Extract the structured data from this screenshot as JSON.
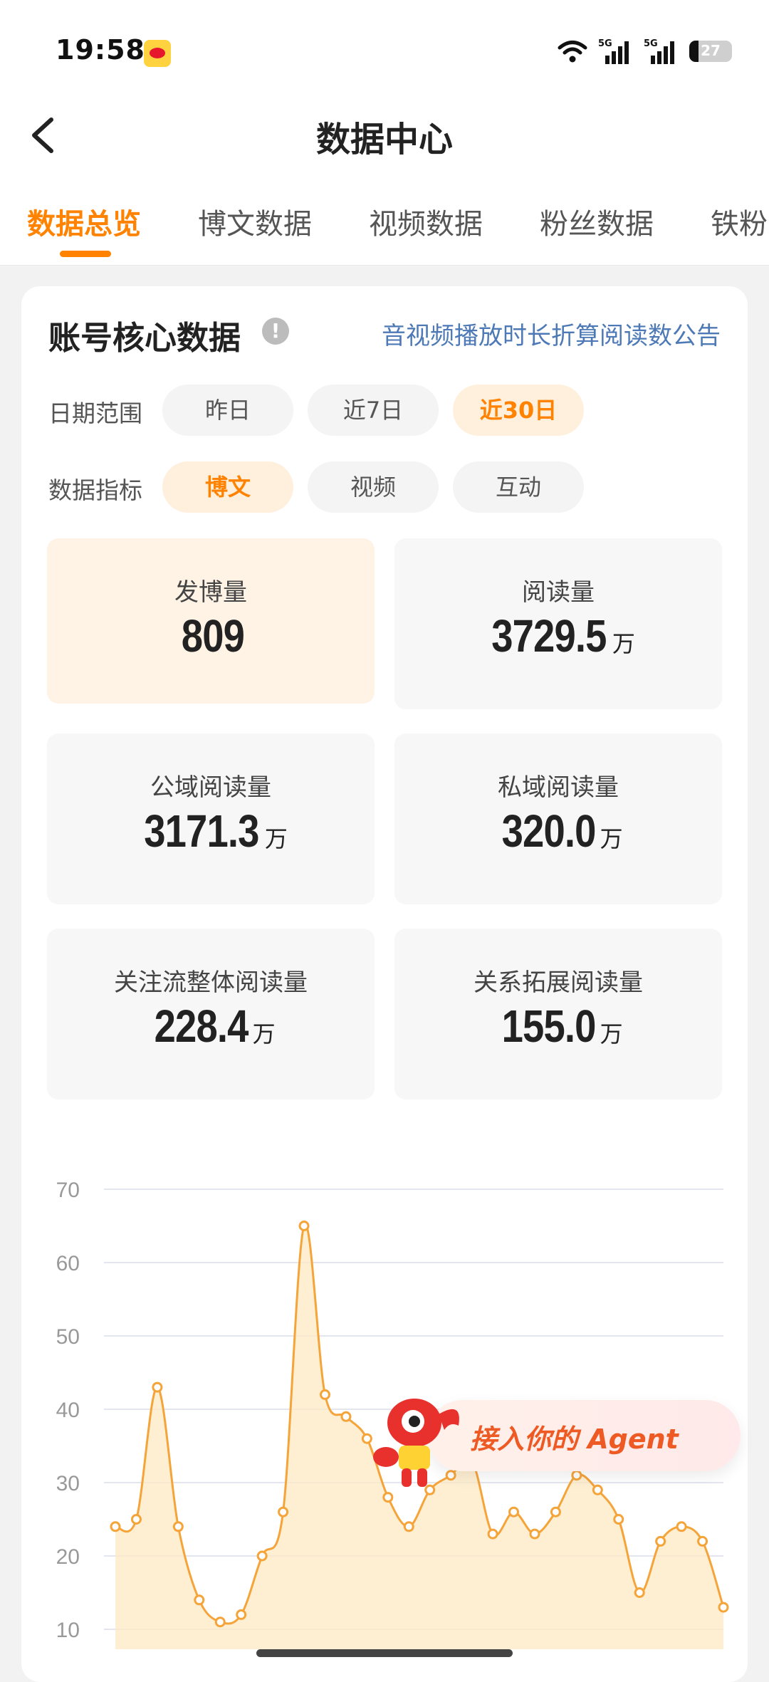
{
  "status_bar": {
    "time": "19:58",
    "network_1": "5G",
    "network_2": "5G",
    "battery": "27",
    "icons": [
      "weibo-icon",
      "wifi-icon",
      "signal-icon",
      "signal-icon",
      "battery-icon"
    ]
  },
  "nav": {
    "title": "数据中心",
    "back_icon": "chevron-left-icon"
  },
  "tabs": [
    {
      "label": "数据总览",
      "active": true
    },
    {
      "label": "博文数据"
    },
    {
      "label": "视频数据"
    },
    {
      "label": "粉丝数据"
    },
    {
      "label": "铁粉"
    }
  ],
  "card": {
    "title": "账号核心数据",
    "notice_link": "音视频播放时长折算阅读数公告",
    "date_range": {
      "label": "日期范围",
      "options": [
        "昨日",
        "近7日",
        "近30日"
      ],
      "selected": "近30日"
    },
    "metric": {
      "label": "数据指标",
      "options": [
        "博文",
        "视频",
        "互动"
      ],
      "selected": "博文"
    },
    "stats": [
      {
        "label": "发博量",
        "value": "809",
        "unit": "",
        "active": true
      },
      {
        "label": "阅读量",
        "value": "3729.5",
        "unit": "万"
      },
      {
        "label": "公域阅读量",
        "value": "3171.3",
        "unit": "万"
      },
      {
        "label": "私域阅读量",
        "value": "320.0",
        "unit": "万"
      },
      {
        "label": "关注流整体阅读量",
        "value": "228.4",
        "unit": "万"
      },
      {
        "label": "关系拓展阅读量",
        "value": "155.0",
        "unit": "万"
      }
    ]
  },
  "chart_data": {
    "type": "area",
    "y_ticks": [
      "70",
      "60",
      "50",
      "40",
      "30",
      "20",
      "10"
    ],
    "ylim": [
      10,
      70
    ],
    "values": [
      24,
      25,
      43,
      24,
      14,
      11,
      12,
      20,
      26,
      65,
      42,
      39,
      36,
      28,
      24,
      29,
      31,
      33,
      23,
      26,
      23,
      26,
      31,
      29,
      25,
      15,
      22,
      24,
      22,
      13
    ],
    "line_color": "#f5a43a",
    "fill_color": "#fde9c4",
    "grid": true
  },
  "agent_banner": {
    "label": "接入你的 Agent",
    "icon": "mascot-icon"
  },
  "colors": {
    "accent": "#ff8200",
    "link": "#4d7ab6"
  }
}
